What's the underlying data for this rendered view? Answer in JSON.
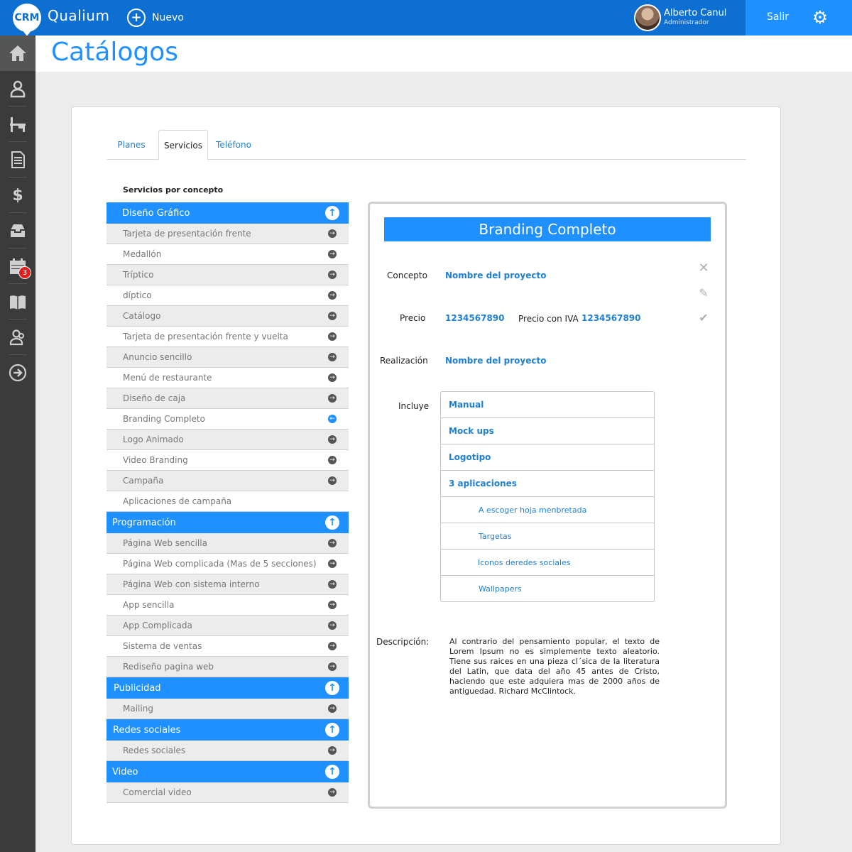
{
  "header": {
    "logo_text": "CRM",
    "brand": "Qualium",
    "new_label": "Nuevo",
    "user_name": "Alberto Canul",
    "user_role": "Administrador",
    "logout_label": "Salir"
  },
  "sidebar": {
    "calendar_badge": "3"
  },
  "page": {
    "title": "Catálogos"
  },
  "tabs": [
    "Planes",
    "Servicios",
    "Teléfono"
  ],
  "services": {
    "section_label": "Servicios por concepto",
    "categories": [
      {
        "name": "Diseño Gráfico",
        "items": [
          "Tarjeta de presentación frente",
          "Medallón",
          "Tríptico",
          "díptico",
          "Catálogo",
          "Tarjeta de presentación frente y vuelta",
          "Anuncio sencillo",
          "Menú de restaurante",
          "Diseño de caja",
          "Branding Completo",
          "Logo Animado",
          "Video Branding",
          "Campaña",
          "Aplicaciones de campaña"
        ]
      },
      {
        "name": "Programación",
        "items": [
          "Página Web sencilla",
          "Página Web complicada (Mas de 5 secciones)",
          "Página Web con sistema interno",
          "App sencilla",
          "App Complicada",
          "Sistema de ventas",
          "Rediseño pagina web"
        ]
      },
      {
        "name": "Publicidad",
        "items": [
          "Mailing"
        ]
      },
      {
        "name": "Redes sociales",
        "items": [
          "Redes sociales"
        ]
      },
      {
        "name": "Video",
        "items": [
          "Comercial video"
        ]
      }
    ]
  },
  "detail": {
    "title": "Branding Completo",
    "concepto_label": "Concepto",
    "concepto_value": "Nombre del proyecto",
    "precio_label": "Precio",
    "precio_value": "1234567890",
    "precio_iva_label": "Precio con IVA",
    "precio_iva_value": "1234567890",
    "realizacion_label": "Realización",
    "realizacion_value": "Nombre del proyecto",
    "incluye_label": "Incluye",
    "incluye": [
      "Manual",
      "Mock ups",
      "Logotipo",
      "3 aplicaciones"
    ],
    "incluye_sub": [
      "A escoger hoja menbretada",
      "Targetas",
      "Iconos deredes sociales",
      "Wallpapers"
    ],
    "descripcion_label": "Descripción:",
    "descripcion": "Al contrario del pensamiento popular, el texto de Lorem Ipsum no es simplemente texto aleatorio. Tiene sus raices en una pieza cl´sica de la literatura del Latin, que data del año 45 antes de Cristo, haciendo que este adquiera mas de 2000 años de antiguedad. Richard McClintock."
  },
  "colors": {
    "primary": "#1e90ff",
    "topbar": "#0d6fd1",
    "sidebar": "#3b3b3b",
    "badge": "#e02020"
  }
}
